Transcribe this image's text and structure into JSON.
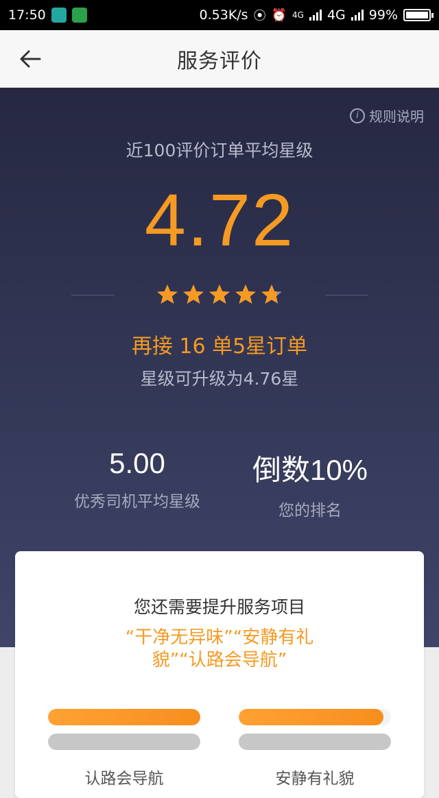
{
  "status_bar": {
    "time": "17:50",
    "net_speed": "0.53K/s",
    "signal_small": "4G",
    "network_label": "4G",
    "battery": "99%"
  },
  "nav": {
    "title": "服务评价"
  },
  "hero": {
    "rules_label": "规则说明",
    "subtitle": "近100评价订单平均星级",
    "score": "4.72",
    "rating": 4.72,
    "star_color": "#f59a23",
    "upgrade_main": "再接 16 单5星订单",
    "upgrade_sub": "星级可升级为4.76星"
  },
  "stats": {
    "excellent": {
      "value": "5.00",
      "label": "优秀司机平均星级"
    },
    "ranking": {
      "value": "倒数10%",
      "label": "您的排名"
    }
  },
  "card": {
    "title": "您还需要提升服务项目",
    "items_line1": "“干净无异味”“安静有礼",
    "items_line2": "貌”“认路会导航”",
    "groups": [
      {
        "label": "认路会导航",
        "fill": 1.0,
        "compare_fill": 1.0
      },
      {
        "label": "安静有礼貌",
        "fill": 0.95,
        "compare_fill": 1.0
      }
    ]
  }
}
